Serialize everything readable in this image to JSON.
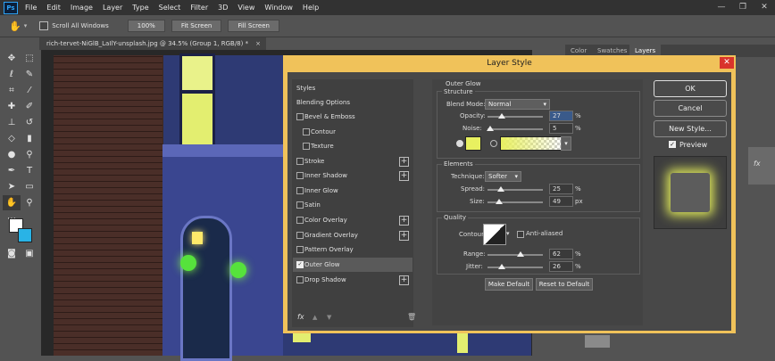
{
  "app": {
    "logo": "Ps"
  },
  "menu": [
    "File",
    "Edit",
    "Image",
    "Layer",
    "Type",
    "Select",
    "Filter",
    "3D",
    "View",
    "Window",
    "Help"
  ],
  "window_controls": [
    "—",
    "❐",
    "✕"
  ],
  "options_bar": {
    "scroll_all_label": "Scroll All Windows",
    "zoom_100": "100%",
    "fit_screen": "Fit Screen",
    "fill_screen": "Fill Screen"
  },
  "document": {
    "tab_title": "rich-tervet-NiGlB_LaIlY-unsplash.jpg @ 34.5% (Group 1, RGB/8) *",
    "close": "×"
  },
  "panels": {
    "tabs": [
      "Color",
      "Swatches",
      "Layers"
    ],
    "active_tab": "Layers",
    "fx": "fx"
  },
  "dialog": {
    "title": "Layer Style",
    "close": "✕",
    "styles_list": [
      {
        "label": "Styles",
        "type": "header"
      },
      {
        "label": "Blending Options",
        "type": "header"
      },
      {
        "label": "Bevel & Emboss",
        "checked": false,
        "plus": false
      },
      {
        "label": "Contour",
        "checked": false,
        "sub": true
      },
      {
        "label": "Texture",
        "checked": false,
        "sub": true
      },
      {
        "label": "Stroke",
        "checked": false,
        "plus": true
      },
      {
        "label": "Inner Shadow",
        "checked": false,
        "plus": true
      },
      {
        "label": "Inner Glow",
        "checked": false,
        "plus": false
      },
      {
        "label": "Satin",
        "checked": false,
        "plus": false
      },
      {
        "label": "Color Overlay",
        "checked": false,
        "plus": true
      },
      {
        "label": "Gradient Overlay",
        "checked": false,
        "plus": true
      },
      {
        "label": "Pattern Overlay",
        "checked": false,
        "plus": false
      },
      {
        "label": "Outer Glow",
        "checked": true,
        "plus": false,
        "active": true
      },
      {
        "label": "Drop Shadow",
        "checked": false,
        "plus": true
      }
    ],
    "footer_icons": [
      "fx",
      "▲",
      "▼",
      "🗑"
    ],
    "outer_glow": {
      "section_title": "Outer Glow",
      "structure": {
        "title": "Structure",
        "blend_mode_label": "Blend Mode:",
        "blend_mode_value": "Normal",
        "opacity_label": "Opacity:",
        "opacity_value": "27",
        "opacity_unit": "%",
        "noise_label": "Noise:",
        "noise_value": "5",
        "noise_unit": "%"
      },
      "elements": {
        "title": "Elements",
        "technique_label": "Technique:",
        "technique_value": "Softer",
        "spread_label": "Spread:",
        "spread_value": "25",
        "spread_unit": "%",
        "size_label": "Size:",
        "size_value": "49",
        "size_unit": "px"
      },
      "quality": {
        "title": "Quality",
        "contour_label": "Contour:",
        "anti_aliased_label": "Anti-aliased",
        "range_label": "Range:",
        "range_value": "62",
        "range_unit": "%",
        "jitter_label": "Jitter:",
        "jitter_value": "26",
        "jitter_unit": "%"
      },
      "make_default": "Make Default",
      "reset_default": "Reset to Default"
    },
    "buttons": {
      "ok": "OK",
      "cancel": "Cancel",
      "new_style": "New Style...",
      "preview": "Preview"
    },
    "colors": {
      "glow": "#e8f060",
      "dialog_frame": "#f0c25a"
    }
  }
}
